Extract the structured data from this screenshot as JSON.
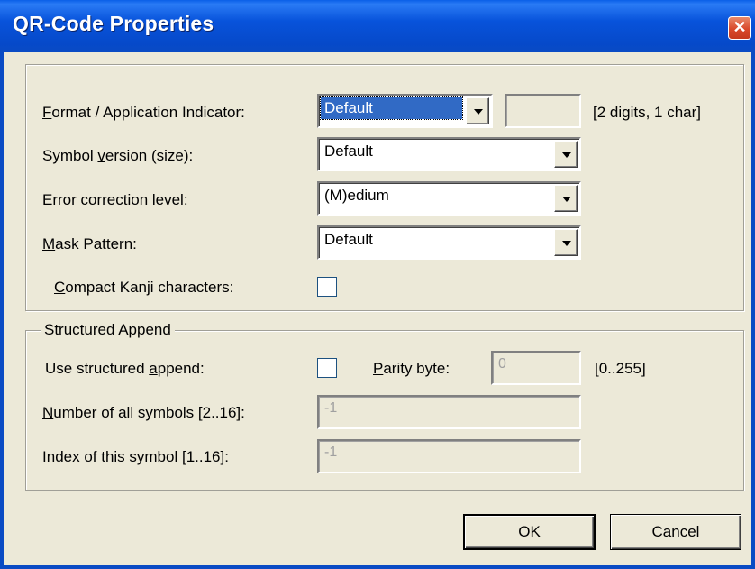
{
  "window": {
    "title": "QR-Code Properties",
    "close_glyph": "✕"
  },
  "format_indicator": {
    "label": "Format / Application Indicator:",
    "access_key": "F",
    "label_rest": "ormat / Application Indicator:",
    "value": "Default",
    "hint": "[2 digits, 1 char]"
  },
  "symbol_version": {
    "label_pre": "Symbol ",
    "access_key": "v",
    "label_post": "ersion (size):",
    "value": "Default"
  },
  "error_correction": {
    "access_key": "E",
    "label_rest": "rror correction level:",
    "value": "(M)edium"
  },
  "mask_pattern": {
    "access_key": "M",
    "label_rest": "ask Pattern:",
    "value": "Default"
  },
  "compact_kanji": {
    "access_key": "C",
    "label_rest": "ompact Kanji characters:",
    "checked": false
  },
  "structured_append": {
    "group_label": "Structured Append",
    "use_label_pre": "Use structured ",
    "use_access_key": "a",
    "use_label_post": "ppend:",
    "use_checked": false,
    "parity_access_key": "P",
    "parity_label_rest": "arity byte:",
    "parity_value": "0",
    "parity_hint": "[0..255]",
    "num_access_key": "N",
    "num_label_rest": "umber of all symbols [2..16]:",
    "num_value": "-1",
    "index_access_key": "I",
    "index_label_rest": "ndex of this symbol [1..16]:",
    "index_value": "-1"
  },
  "buttons": {
    "ok": "OK",
    "cancel": "Cancel"
  }
}
